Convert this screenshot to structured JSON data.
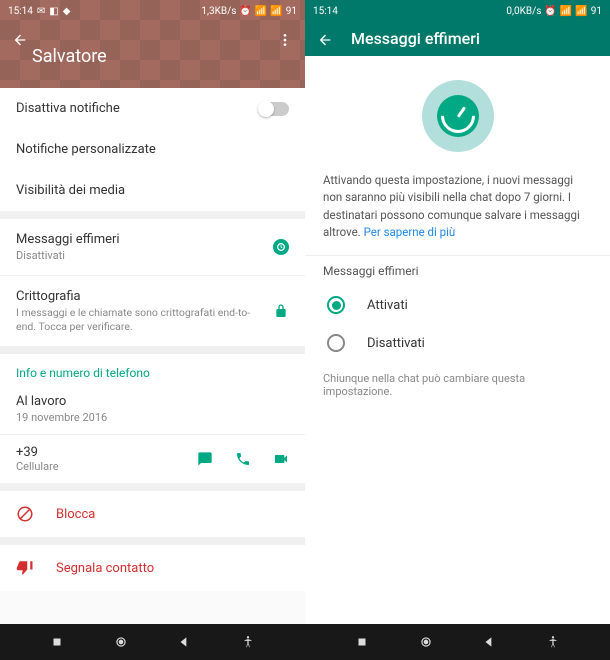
{
  "status": {
    "time": "15:14",
    "net_left": "1,3KB/s",
    "net_right": "0,0KB/s",
    "battery": "91"
  },
  "left": {
    "contact_name": "Salvatore",
    "mute": "Disattiva notifiche",
    "custom_notif": "Notifiche personalizzate",
    "media_vis": "Visibilità dei media",
    "disappearing": "Messaggi effimeri",
    "disappearing_sub": "Disattivati",
    "encryption": "Crittografia",
    "encryption_sub": "I messaggi e le chiamate sono crittografati end-to-end. Tocca per verificare.",
    "info_section": "Info e numero di telefono",
    "about": "Al lavoro",
    "about_date": "19 novembre 2016",
    "phone": "+39",
    "phone_label": "Cellulare",
    "block": "Blocca",
    "report": "Segnala contatto"
  },
  "right": {
    "title": "Messaggi effimeri",
    "desc_part1": "Attivando questa impostazione, i nuovi messaggi non saranno più visibili nella chat dopo 7 giorni. I destinatari possono comunque salvare i messaggi altrove. ",
    "desc_link": "Per saperne di più",
    "option_title": "Messaggi effimeri",
    "opt_on": "Attivati",
    "opt_off": "Disattivati",
    "note": "Chiunque nella chat può cambiare questa impostazione."
  }
}
